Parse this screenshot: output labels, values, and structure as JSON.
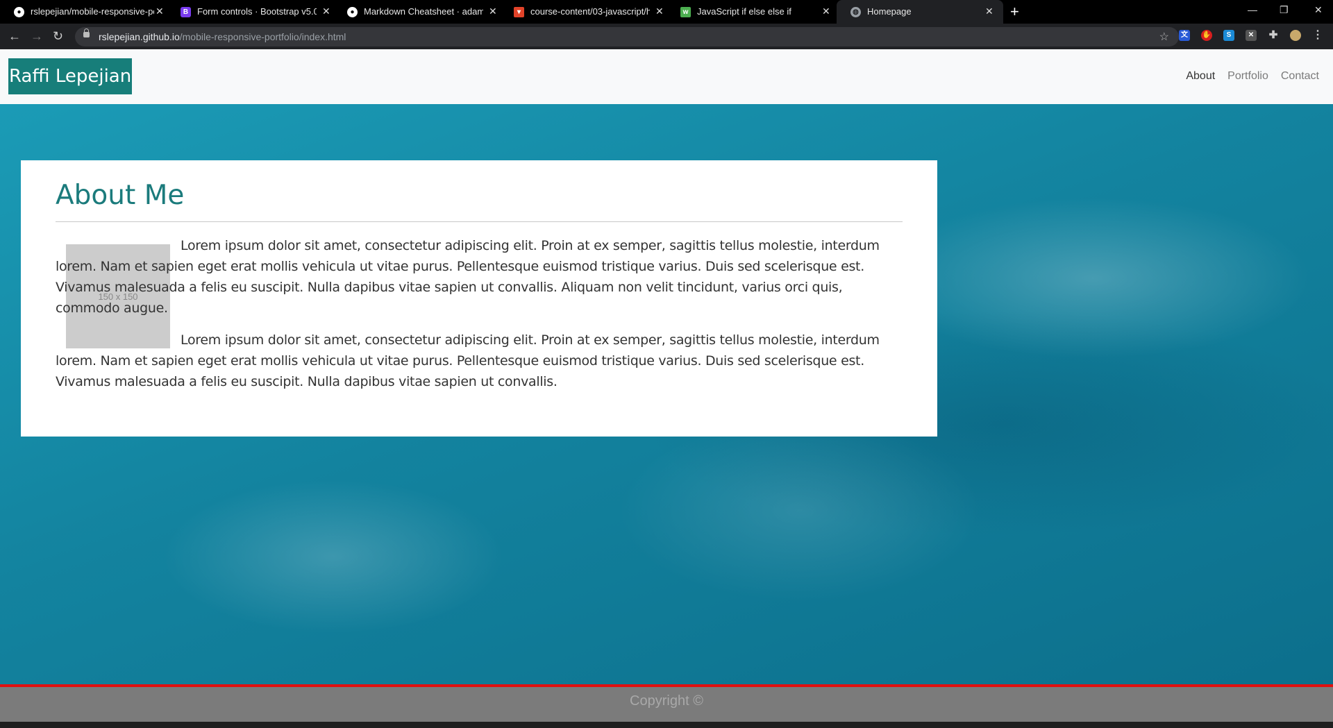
{
  "browser": {
    "tabs": [
      {
        "title": "rslepejian/mobile-responsive-po",
        "icon": "github-icon"
      },
      {
        "title": "Form controls · Bootstrap v5.0",
        "icon": "bootstrap-icon"
      },
      {
        "title": "Markdown Cheatsheet · adam-p/",
        "icon": "github-icon"
      },
      {
        "title": "course-content/03-javascript/ho",
        "icon": "gitlab-icon"
      },
      {
        "title": "JavaScript if else else if",
        "icon": "w3schools-icon"
      },
      {
        "title": "Homepage",
        "icon": "globe-icon",
        "active": true
      }
    ],
    "url_host": "rslepejian.github.io",
    "url_path": "/mobile-responsive-portfolio/index.html"
  },
  "nav": {
    "brand": "Raffi Lepejian",
    "links": [
      "About",
      "Portfolio",
      "Contact"
    ]
  },
  "about": {
    "heading": "About Me",
    "placeholder_label": "150 x 150",
    "paragraph1": "Lorem ipsum dolor sit amet, consectetur adipiscing elit. Proin at ex semper, sagittis tellus molestie, interdum lorem. Nam et sapien eget erat mollis vehicula ut vitae purus. Pellentesque euismod tristique varius. Duis sed scelerisque est. Vivamus malesuada a felis eu suscipit. Nulla dapibus vitae sapien ut convallis. Aliquam non velit tincidunt, varius orci quis, commodo augue.",
    "paragraph2": "Lorem ipsum dolor sit amet, consectetur adipiscing elit. Proin at ex semper, sagittis tellus molestie, interdum lorem. Nam et sapien eget erat mollis vehicula ut vitae purus. Pellentesque euismod tristique varius. Duis sed scelerisque est. Vivamus malesuada a felis eu suscipit. Nulla dapibus vitae sapien ut convallis."
  },
  "footer": {
    "text": "Copyright ©"
  },
  "colors": {
    "brand": "#177e7a",
    "footer_accent": "#e01010",
    "footer_bg": "#7b7b7b"
  }
}
